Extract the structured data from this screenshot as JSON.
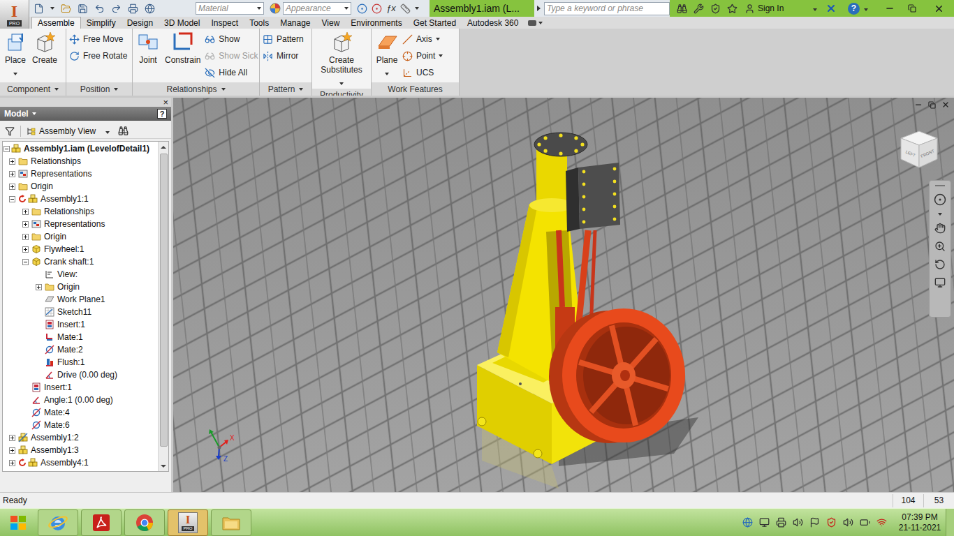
{
  "app": {
    "logo": "I",
    "edition": "PRO"
  },
  "title_bar": {
    "material": "Material",
    "appearance": "Appearance",
    "formula": "ƒx",
    "title": "Assembly1.iam (L...",
    "search_placeholder": "Type a keyword or phrase",
    "sign_in": "Sign In",
    "help": "?"
  },
  "tabs": [
    {
      "label": "Assemble",
      "selected": true
    },
    {
      "label": "Simplify",
      "selected": false
    },
    {
      "label": "Design",
      "selected": false
    },
    {
      "label": "3D Model",
      "selected": false
    },
    {
      "label": "Inspect",
      "selected": false
    },
    {
      "label": "Tools",
      "selected": false
    },
    {
      "label": "Manage",
      "selected": false
    },
    {
      "label": "View",
      "selected": false
    },
    {
      "label": "Environments",
      "selected": false
    },
    {
      "label": "Get Started",
      "selected": false
    },
    {
      "label": "Autodesk 360",
      "selected": false
    }
  ],
  "ribbon": {
    "groups": [
      {
        "label": "Component",
        "dropdown": true,
        "buttons": [
          {
            "label": "Place",
            "size": "large",
            "dropdown": true,
            "disabled": false
          },
          {
            "label": "Create",
            "size": "large",
            "dropdown": false,
            "disabled": false
          }
        ]
      },
      {
        "label": "Position",
        "dropdown": true,
        "buttons": [
          {
            "label": "Free Move",
            "size": "small",
            "dropdown": false,
            "disabled": false
          },
          {
            "label": "Free Rotate",
            "size": "small",
            "dropdown": false,
            "disabled": false
          }
        ]
      },
      {
        "label": "Relationships",
        "dropdown": true,
        "buttons": [
          {
            "label": "Joint",
            "size": "large",
            "dropdown": false,
            "disabled": false
          },
          {
            "label": "Constrain",
            "size": "large",
            "dropdown": false,
            "disabled": false
          },
          {
            "label": "Show",
            "size": "small",
            "dropdown": false,
            "disabled": false
          },
          {
            "label": "Show Sick",
            "size": "small",
            "dropdown": false,
            "disabled": true
          },
          {
            "label": "Hide All",
            "size": "small",
            "dropdown": false,
            "disabled": false
          }
        ]
      },
      {
        "label": "Pattern",
        "dropdown": true,
        "buttons": [
          {
            "label": "Pattern",
            "size": "small",
            "dropdown": false,
            "disabled": false
          },
          {
            "label": "Mirror",
            "size": "small",
            "dropdown": false,
            "disabled": false
          }
        ]
      },
      {
        "label": "Productivity",
        "dropdown": false,
        "buttons": [
          {
            "label": "Create Substitutes",
            "size": "large",
            "dropdown": true,
            "disabled": false
          }
        ]
      },
      {
        "label": "Work Features",
        "dropdown": false,
        "buttons": [
          {
            "label": "Plane",
            "size": "large",
            "dropdown": true,
            "disabled": false
          },
          {
            "label": "Axis",
            "size": "small",
            "dropdown": true,
            "disabled": false
          },
          {
            "label": "Point",
            "size": "small",
            "dropdown": true,
            "disabled": false
          },
          {
            "label": "UCS",
            "size": "small",
            "dropdown": false,
            "disabled": false
          }
        ]
      }
    ]
  },
  "browser": {
    "title": "Model",
    "view_mode": "Assembly View",
    "help": "?",
    "close": "×",
    "tree": [
      {
        "label": "Assembly1.iam (LevelofDetail1)",
        "depth": 0,
        "kind": "root",
        "expandable": true,
        "expanded": true
      },
      {
        "label": "Relationships",
        "depth": 1,
        "kind": "folder",
        "expandable": true,
        "expanded": false
      },
      {
        "label": "Representations",
        "depth": 1,
        "kind": "reps",
        "expandable": true,
        "expanded": false
      },
      {
        "label": "Origin",
        "depth": 1,
        "kind": "folder",
        "expandable": true,
        "expanded": false
      },
      {
        "label": "Assembly1:1",
        "depth": 1,
        "kind": "assembly-flex",
        "expandable": true,
        "expanded": true
      },
      {
        "label": "Relationships",
        "depth": 2,
        "kind": "folder",
        "expandable": true,
        "expanded": false
      },
      {
        "label": "Representations",
        "depth": 2,
        "kind": "reps",
        "expandable": true,
        "expanded": false
      },
      {
        "label": "Origin",
        "depth": 2,
        "kind": "folder",
        "expandable": true,
        "expanded": false
      },
      {
        "label": "Flywheel:1",
        "depth": 2,
        "kind": "part",
        "expandable": true,
        "expanded": false
      },
      {
        "label": "Crank shaft:1",
        "depth": 2,
        "kind": "part",
        "expandable": true,
        "expanded": true
      },
      {
        "label": "View:",
        "depth": 3,
        "kind": "view",
        "expandable": false,
        "expanded": false
      },
      {
        "label": "Origin",
        "depth": 3,
        "kind": "folder",
        "expandable": true,
        "expanded": false
      },
      {
        "label": "Work Plane1",
        "depth": 3,
        "kind": "workplane",
        "expandable": false,
        "expanded": false
      },
      {
        "label": "Sketch11",
        "depth": 3,
        "kind": "sketch",
        "expandable": false,
        "expanded": false
      },
      {
        "label": "Insert:1",
        "depth": 3,
        "kind": "insert",
        "expandable": false,
        "expanded": false
      },
      {
        "label": "Mate:1",
        "depth": 3,
        "kind": "mate",
        "expandable": false,
        "expanded": false
      },
      {
        "label": "Mate:2",
        "depth": 3,
        "kind": "mate-axis",
        "expandable": false,
        "expanded": false
      },
      {
        "label": "Flush:1",
        "depth": 3,
        "kind": "flush",
        "expandable": false,
        "expanded": false
      },
      {
        "label": "Drive (0.00 deg)",
        "depth": 3,
        "kind": "angle",
        "expandable": false,
        "expanded": false
      },
      {
        "label": "Insert:1",
        "depth": 2,
        "kind": "insert",
        "expandable": false,
        "expanded": false
      },
      {
        "label": "Angle:1 (0.00 deg)",
        "depth": 2,
        "kind": "angle",
        "expandable": false,
        "expanded": false
      },
      {
        "label": "Mate:4",
        "depth": 2,
        "kind": "mate-axis",
        "expandable": false,
        "expanded": false
      },
      {
        "label": "Mate:6",
        "depth": 2,
        "kind": "mate-axis",
        "expandable": false,
        "expanded": false
      },
      {
        "label": "Assembly1:2",
        "depth": 1,
        "kind": "assembly-alt",
        "expandable": true,
        "expanded": false
      },
      {
        "label": "Assembly1:3",
        "depth": 1,
        "kind": "assembly",
        "expandable": true,
        "expanded": false
      },
      {
        "label": "Assembly4:1",
        "depth": 1,
        "kind": "assembly-flex",
        "expandable": true,
        "expanded": false
      }
    ]
  },
  "viewport": {
    "view_cube": [
      "LEFT",
      "FRONT"
    ],
    "axes": [
      {
        "label": "X",
        "color": "#e0201c"
      },
      {
        "label": "Z",
        "color": "#1a3cc8"
      }
    ]
  },
  "status_bar": {
    "text": "Ready",
    "fields": [
      "104",
      "53"
    ]
  },
  "taskbar": {
    "apps": [
      {
        "kind": "ie",
        "selected": false
      },
      {
        "kind": "acrobat",
        "selected": false
      },
      {
        "kind": "chrome",
        "selected": false
      },
      {
        "kind": "inventor",
        "selected": true
      },
      {
        "kind": "explorer",
        "selected": false
      }
    ],
    "time": "07:39 PM",
    "date": "21-11-2021"
  }
}
